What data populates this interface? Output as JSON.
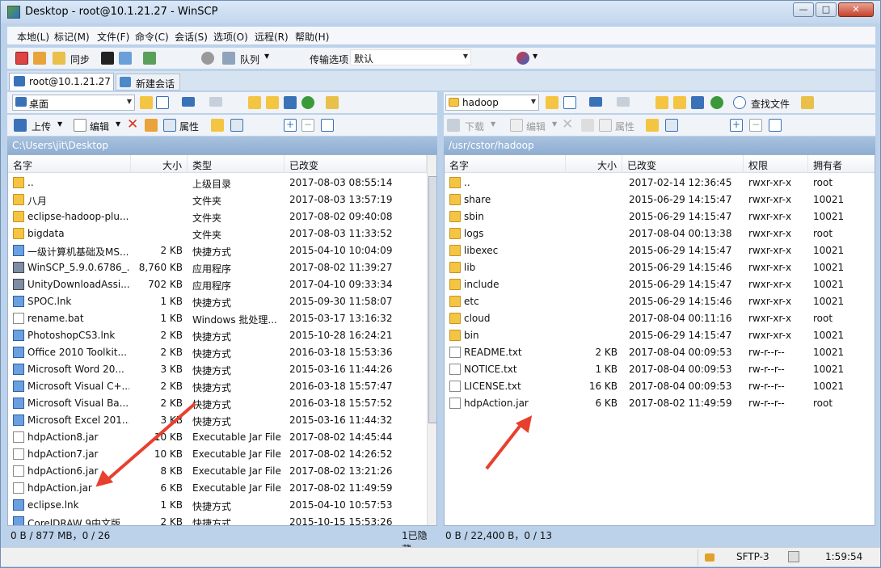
{
  "window": {
    "title": "Desktop - root@10.1.21.27 - WinSCP"
  },
  "menu": [
    "本地(L)",
    "标记(M)",
    "文件(F)",
    "命令(C)",
    "会话(S)",
    "选项(O)",
    "远程(R)",
    "帮助(H)"
  ],
  "toolbar": {
    "sync": "同步",
    "queue": "队列",
    "transfer_label": "传输选项",
    "transfer_value": "默认"
  },
  "tabs": {
    "session": "root@10.1.21.27",
    "new": "新建会话"
  },
  "left": {
    "location": "桌面",
    "path": "C:\\Users\\jit\\Desktop",
    "actions": {
      "upload": "上传",
      "edit": "编辑",
      "props": "属性"
    },
    "cols": [
      "名字",
      "大小",
      "类型",
      "已改变"
    ],
    "rows": [
      [
        "..",
        "",
        "上级目录",
        "2017-08-03  08:55:14"
      ],
      [
        "八月",
        "",
        "文件夹",
        "2017-08-03  13:57:19"
      ],
      [
        "eclipse-hadoop-plu...",
        "",
        "文件夹",
        "2017-08-02  09:40:08"
      ],
      [
        "bigdata",
        "",
        "文件夹",
        "2017-08-03  11:33:52"
      ],
      [
        "一级计算机基础及MS...",
        "2 KB",
        "快捷方式",
        "2015-04-10  10:04:09"
      ],
      [
        "WinSCP_5.9.0.6786_...",
        "8,760 KB",
        "应用程序",
        "2017-08-02  11:39:27"
      ],
      [
        "UnityDownloadAssi...",
        "702 KB",
        "应用程序",
        "2017-04-10  09:33:34"
      ],
      [
        "SPOC.lnk",
        "1 KB",
        "快捷方式",
        "2015-09-30  11:58:07"
      ],
      [
        "rename.bat",
        "1 KB",
        "Windows 批处理...",
        "2015-03-17  13:16:32"
      ],
      [
        "PhotoshopCS3.lnk",
        "2 KB",
        "快捷方式",
        "2015-10-28  16:24:21"
      ],
      [
        "Office 2010 Toolkit...",
        "2 KB",
        "快捷方式",
        "2016-03-18  15:53:36"
      ],
      [
        "Microsoft Word 20...",
        "3 KB",
        "快捷方式",
        "2015-03-16  11:44:26"
      ],
      [
        "Microsoft Visual C+...",
        "2 KB",
        "快捷方式",
        "2016-03-18  15:57:47"
      ],
      [
        "Microsoft Visual Ba...",
        "2 KB",
        "快捷方式",
        "2016-03-18  15:57:52"
      ],
      [
        "Microsoft Excel 201...",
        "3 KB",
        "快捷方式",
        "2015-03-16  11:44:32"
      ],
      [
        "hdpAction8.jar",
        "10 KB",
        "Executable Jar File",
        "2017-08-02  14:45:44"
      ],
      [
        "hdpAction7.jar",
        "10 KB",
        "Executable Jar File",
        "2017-08-02  14:26:52"
      ],
      [
        "hdpAction6.jar",
        "8 KB",
        "Executable Jar File",
        "2017-08-02  13:21:26"
      ],
      [
        "hdpAction.jar",
        "6 KB",
        "Executable Jar File",
        "2017-08-02  11:49:59"
      ],
      [
        "eclipse.lnk",
        "1 KB",
        "快捷方式",
        "2015-04-10  10:57:53"
      ],
      [
        "CorelDRAW 9中文版...",
        "2 KB",
        "快捷方式",
        "2015-10-15  15:53:26"
      ]
    ],
    "kinds": [
      "up",
      "fold",
      "fold",
      "fold",
      "lnk",
      "exe",
      "exe",
      "lnk",
      "file",
      "lnk",
      "lnk",
      "lnk",
      "lnk",
      "lnk",
      "lnk",
      "file",
      "file",
      "file",
      "file",
      "lnk",
      "lnk"
    ],
    "status": "0 B / 877 MB，0 / 26",
    "hidden": "1已隐藏"
  },
  "right": {
    "location": "hadoop",
    "path": "/usr/cstor/hadoop",
    "actions": {
      "download": "下载",
      "edit": "编辑",
      "props": "属性",
      "find": "查找文件"
    },
    "cols": [
      "名字",
      "大小",
      "已改变",
      "权限",
      "拥有者"
    ],
    "rows": [
      [
        "..",
        "",
        "2017-02-14  12:36:45",
        "rwxr-xr-x",
        "root"
      ],
      [
        "share",
        "",
        "2015-06-29  14:15:47",
        "rwxr-xr-x",
        "10021"
      ],
      [
        "sbin",
        "",
        "2015-06-29  14:15:47",
        "rwxr-xr-x",
        "10021"
      ],
      [
        "logs",
        "",
        "2017-08-04  00:13:38",
        "rwxr-xr-x",
        "root"
      ],
      [
        "libexec",
        "",
        "2015-06-29  14:15:47",
        "rwxr-xr-x",
        "10021"
      ],
      [
        "lib",
        "",
        "2015-06-29  14:15:46",
        "rwxr-xr-x",
        "10021"
      ],
      [
        "include",
        "",
        "2015-06-29  14:15:47",
        "rwxr-xr-x",
        "10021"
      ],
      [
        "etc",
        "",
        "2015-06-29  14:15:46",
        "rwxr-xr-x",
        "10021"
      ],
      [
        "cloud",
        "",
        "2017-08-04  00:11:16",
        "rwxr-xr-x",
        "root"
      ],
      [
        "bin",
        "",
        "2015-06-29  14:15:47",
        "rwxr-xr-x",
        "10021"
      ],
      [
        "README.txt",
        "2 KB",
        "2017-08-04  00:09:53",
        "rw-r--r--",
        "10021"
      ],
      [
        "NOTICE.txt",
        "1 KB",
        "2017-08-04  00:09:53",
        "rw-r--r--",
        "10021"
      ],
      [
        "LICENSE.txt",
        "16 KB",
        "2017-08-04  00:09:53",
        "rw-r--r--",
        "10021"
      ],
      [
        "hdpAction.jar",
        "6 KB",
        "2017-08-02  11:49:59",
        "rw-r--r--",
        "root"
      ]
    ],
    "kinds": [
      "up",
      "fold",
      "fold",
      "fold",
      "fold",
      "fold",
      "fold",
      "fold",
      "fold",
      "fold",
      "file",
      "file",
      "file",
      "file"
    ],
    "status": "0 B / 22,400 B，0 / 13"
  },
  "statusbar": {
    "protocol": "SFTP-3",
    "time": "1:59:54"
  },
  "colors": {
    "accent": "#e8402e",
    "pathbar": "#8eaed2"
  }
}
